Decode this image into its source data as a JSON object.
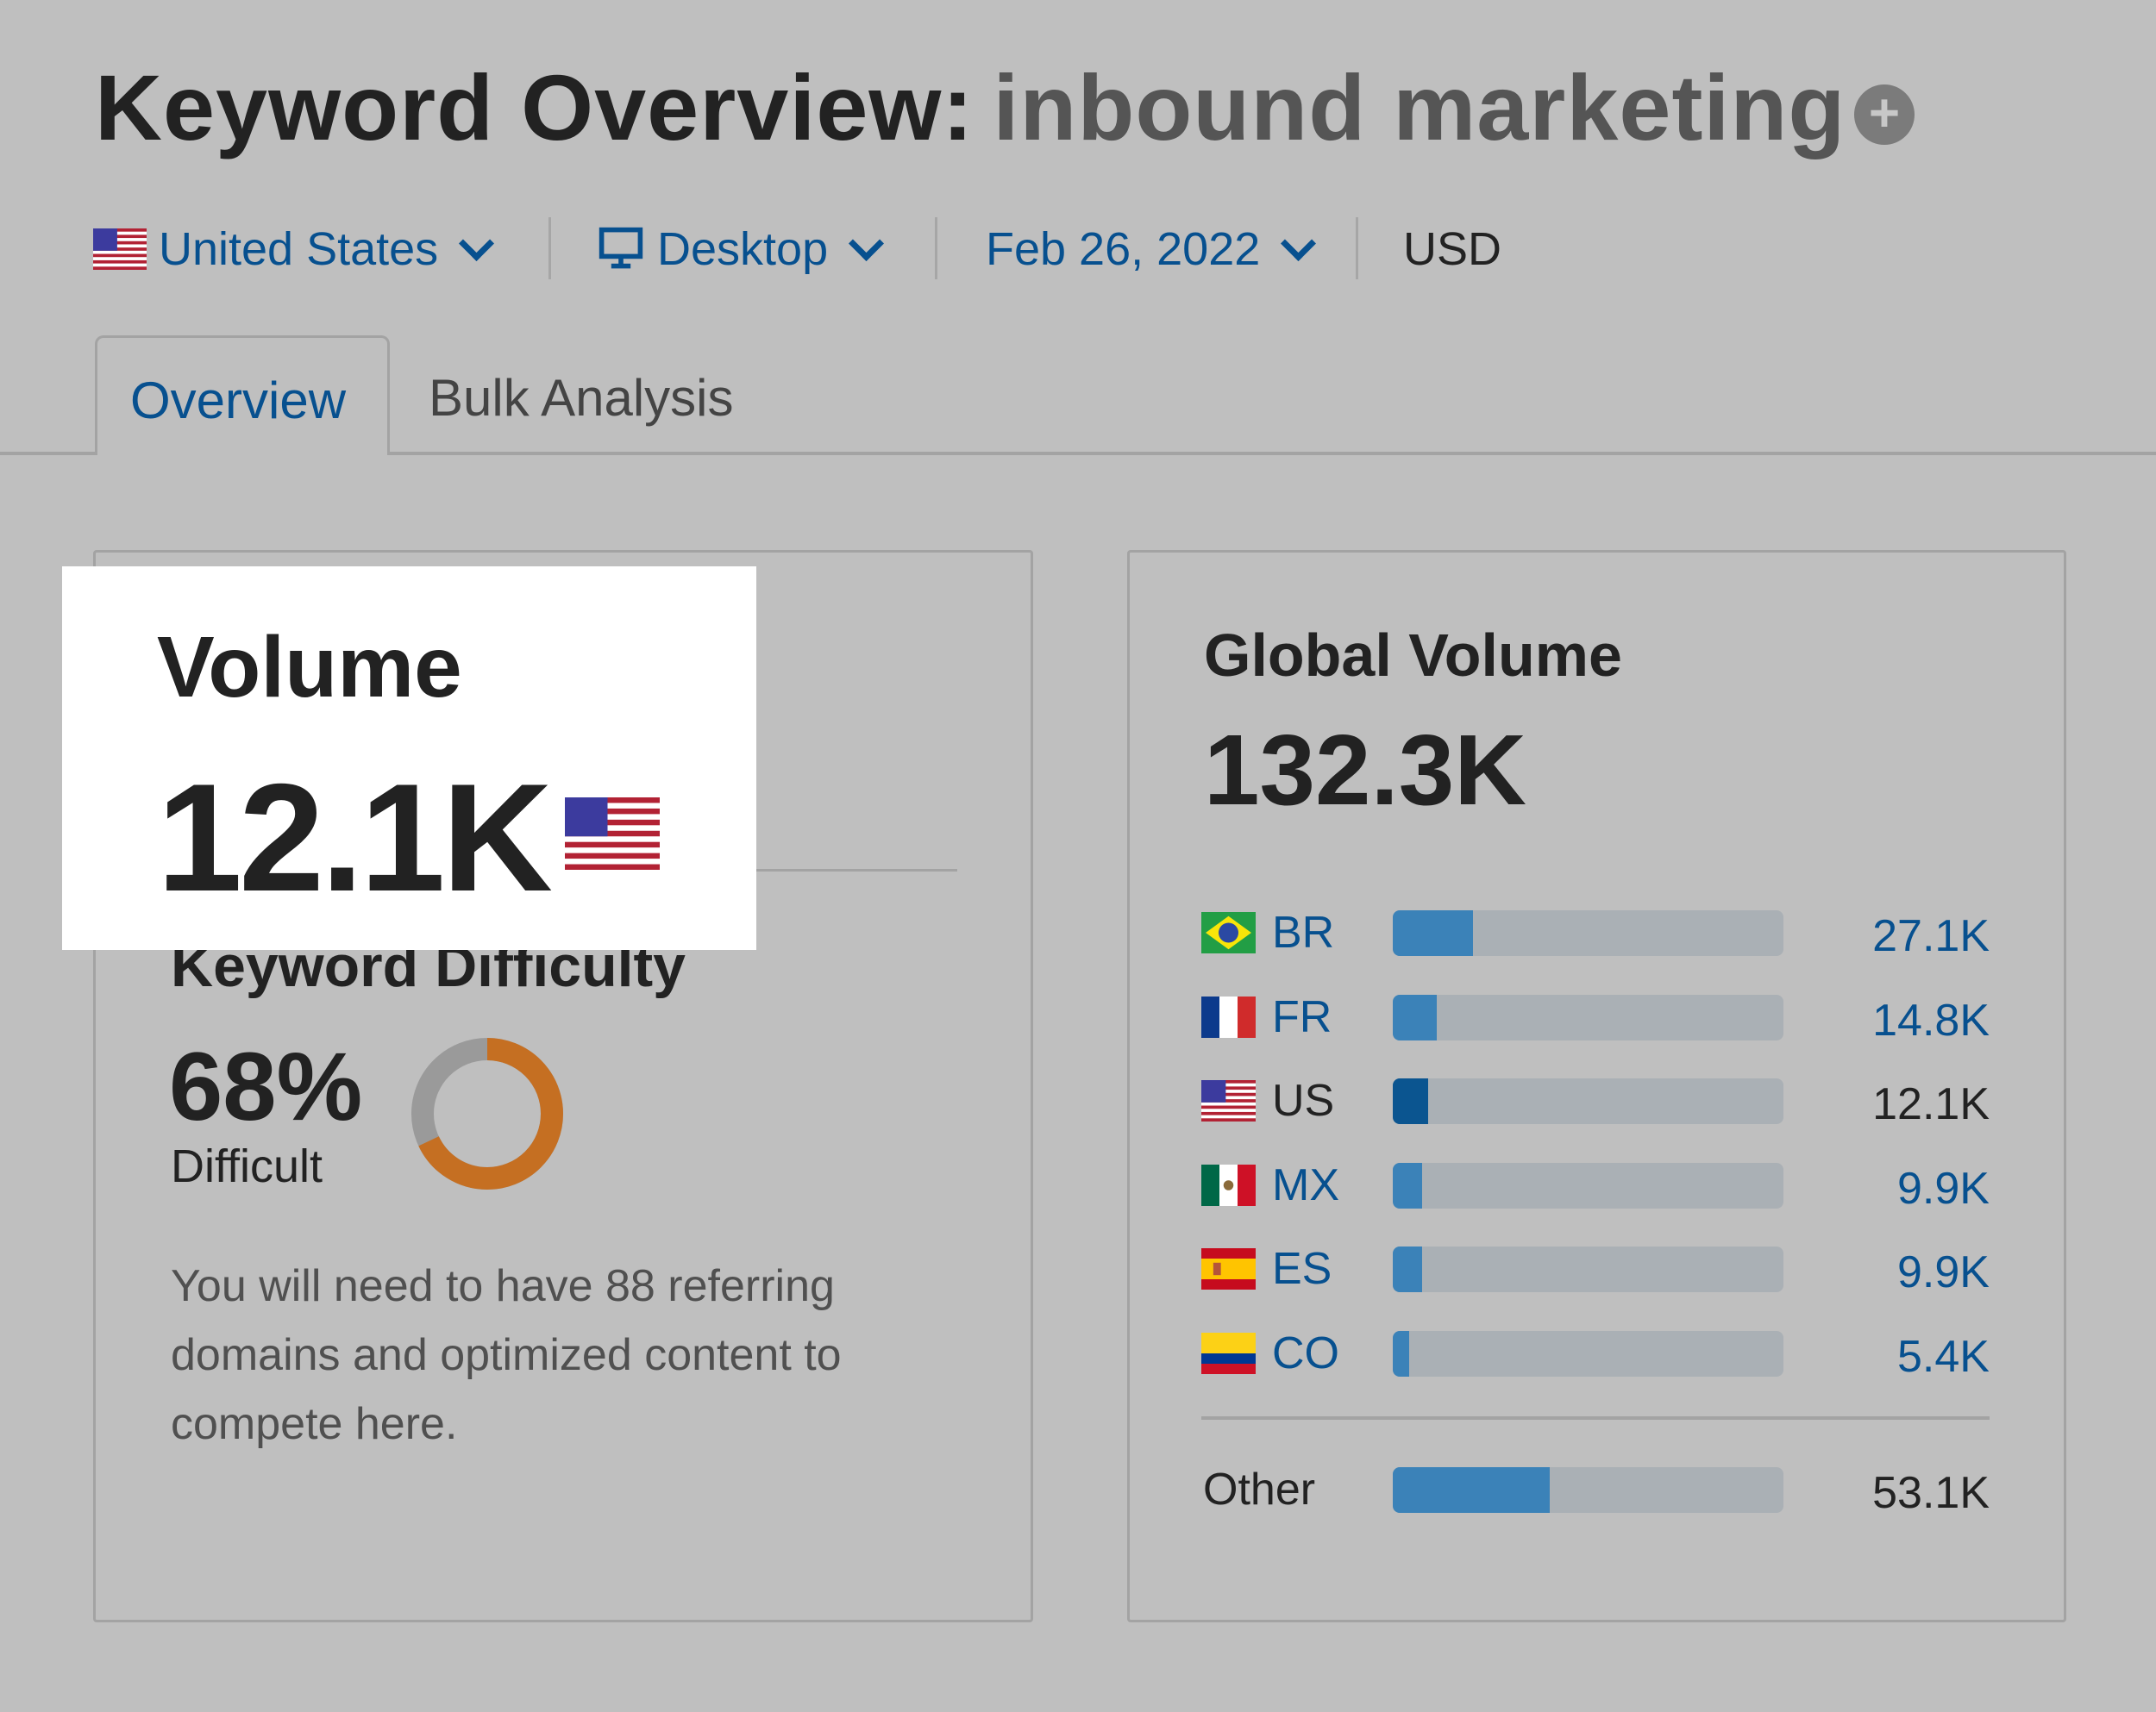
{
  "header": {
    "title_prefix": "Keyword Overview:",
    "keyword": "inbound marketing",
    "add_icon": "plus-circle-icon"
  },
  "filters": {
    "country": "United States",
    "device": "Desktop",
    "date": "Feb 26, 2022",
    "currency": "USD"
  },
  "tabs": [
    {
      "label": "Overview",
      "active": true
    },
    {
      "label": "Bulk Analysis",
      "active": false
    }
  ],
  "volume": {
    "label": "Volume",
    "value": "12.1K",
    "flag": "us"
  },
  "keyword_difficulty": {
    "title": "Keyword Difficulty",
    "percent_label": "68%",
    "percent": 68,
    "level": "Difficult",
    "description": "You will need to have 88 referring domains and optimized content to compete here.",
    "colors": {
      "filled": "#c56f22",
      "empty": "#9a9a9a"
    }
  },
  "global_volume": {
    "title": "Global Volume",
    "total_label": "132.3K",
    "total": 132.3,
    "countries": [
      {
        "code": "BR",
        "value_label": "27.1K",
        "value": 27.1,
        "link": true
      },
      {
        "code": "FR",
        "value_label": "14.8K",
        "value": 14.8,
        "link": true
      },
      {
        "code": "US",
        "value_label": "12.1K",
        "value": 12.1,
        "link": false
      },
      {
        "code": "MX",
        "value_label": "9.9K",
        "value": 9.9,
        "link": true
      },
      {
        "code": "ES",
        "value_label": "9.9K",
        "value": 9.9,
        "link": true
      },
      {
        "code": "CO",
        "value_label": "5.4K",
        "value": 5.4,
        "link": true
      }
    ],
    "other": {
      "label": "Other",
      "value_label": "53.1K",
      "value": 53.1
    },
    "colors": {
      "bar": "#3b82b8",
      "bar_selected": "#0b5590",
      "track": "#aab0b5",
      "link": "#07508f"
    }
  }
}
